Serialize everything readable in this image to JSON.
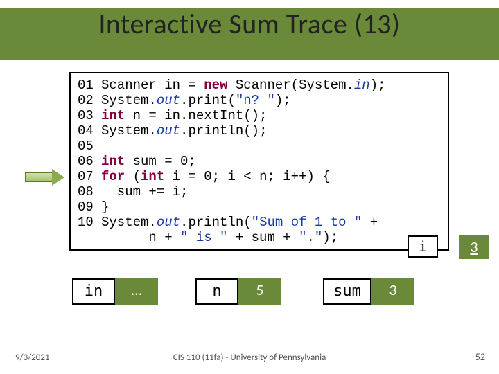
{
  "title": "Interactive Sum Trace (13)",
  "code": {
    "lines": [
      {
        "n": "01",
        "segs": [
          {
            "t": "Scanner in = "
          },
          {
            "t": "new",
            "c": "kw"
          },
          {
            "t": " Scanner(System."
          },
          {
            "t": "in",
            "c": "fld"
          },
          {
            "t": ");"
          }
        ]
      },
      {
        "n": "02",
        "segs": [
          {
            "t": "System."
          },
          {
            "t": "out",
            "c": "fld"
          },
          {
            "t": ".print("
          },
          {
            "t": "\"n? \"",
            "c": "str"
          },
          {
            "t": ");"
          }
        ]
      },
      {
        "n": "03",
        "segs": [
          {
            "t": "int",
            "c": "kw"
          },
          {
            "t": " n = in.nextInt();"
          }
        ]
      },
      {
        "n": "04",
        "segs": [
          {
            "t": "System."
          },
          {
            "t": "out",
            "c": "fld"
          },
          {
            "t": ".println();"
          }
        ]
      },
      {
        "n": "05",
        "segs": []
      },
      {
        "n": "06",
        "segs": [
          {
            "t": "int",
            "c": "kw"
          },
          {
            "t": " sum = 0;"
          }
        ]
      },
      {
        "n": "07",
        "segs": [
          {
            "t": "for",
            "c": "kw"
          },
          {
            "t": " ("
          },
          {
            "t": "int",
            "c": "kw"
          },
          {
            "t": " i = 0; i < n; i++) {"
          }
        ]
      },
      {
        "n": "08",
        "segs": [
          {
            "t": "  sum += i;"
          }
        ]
      },
      {
        "n": "09",
        "segs": [
          {
            "t": "}"
          }
        ]
      },
      {
        "n": "10",
        "segs": [
          {
            "t": "System."
          },
          {
            "t": "out",
            "c": "fld"
          },
          {
            "t": ".println("
          },
          {
            "t": "\"Sum of 1 to \"",
            "c": "str"
          },
          {
            "t": " +"
          }
        ]
      },
      {
        "n": "",
        "segs": [
          {
            "t": "      n + "
          },
          {
            "t": "\" is \"",
            "c": "str"
          },
          {
            "t": " + sum + "
          },
          {
            "t": "\".\"",
            "c": "str"
          },
          {
            "t": ");"
          }
        ]
      }
    ]
  },
  "i_label": "i",
  "i_value": "3",
  "vars": {
    "in": "in",
    "dots": "…",
    "n": "n",
    "n_val": "5",
    "sum": "sum",
    "sum_val": "3"
  },
  "date": "9/3/2021",
  "footer": "CIS 110 (11fa) - University of Pennsylvania",
  "page": "52"
}
